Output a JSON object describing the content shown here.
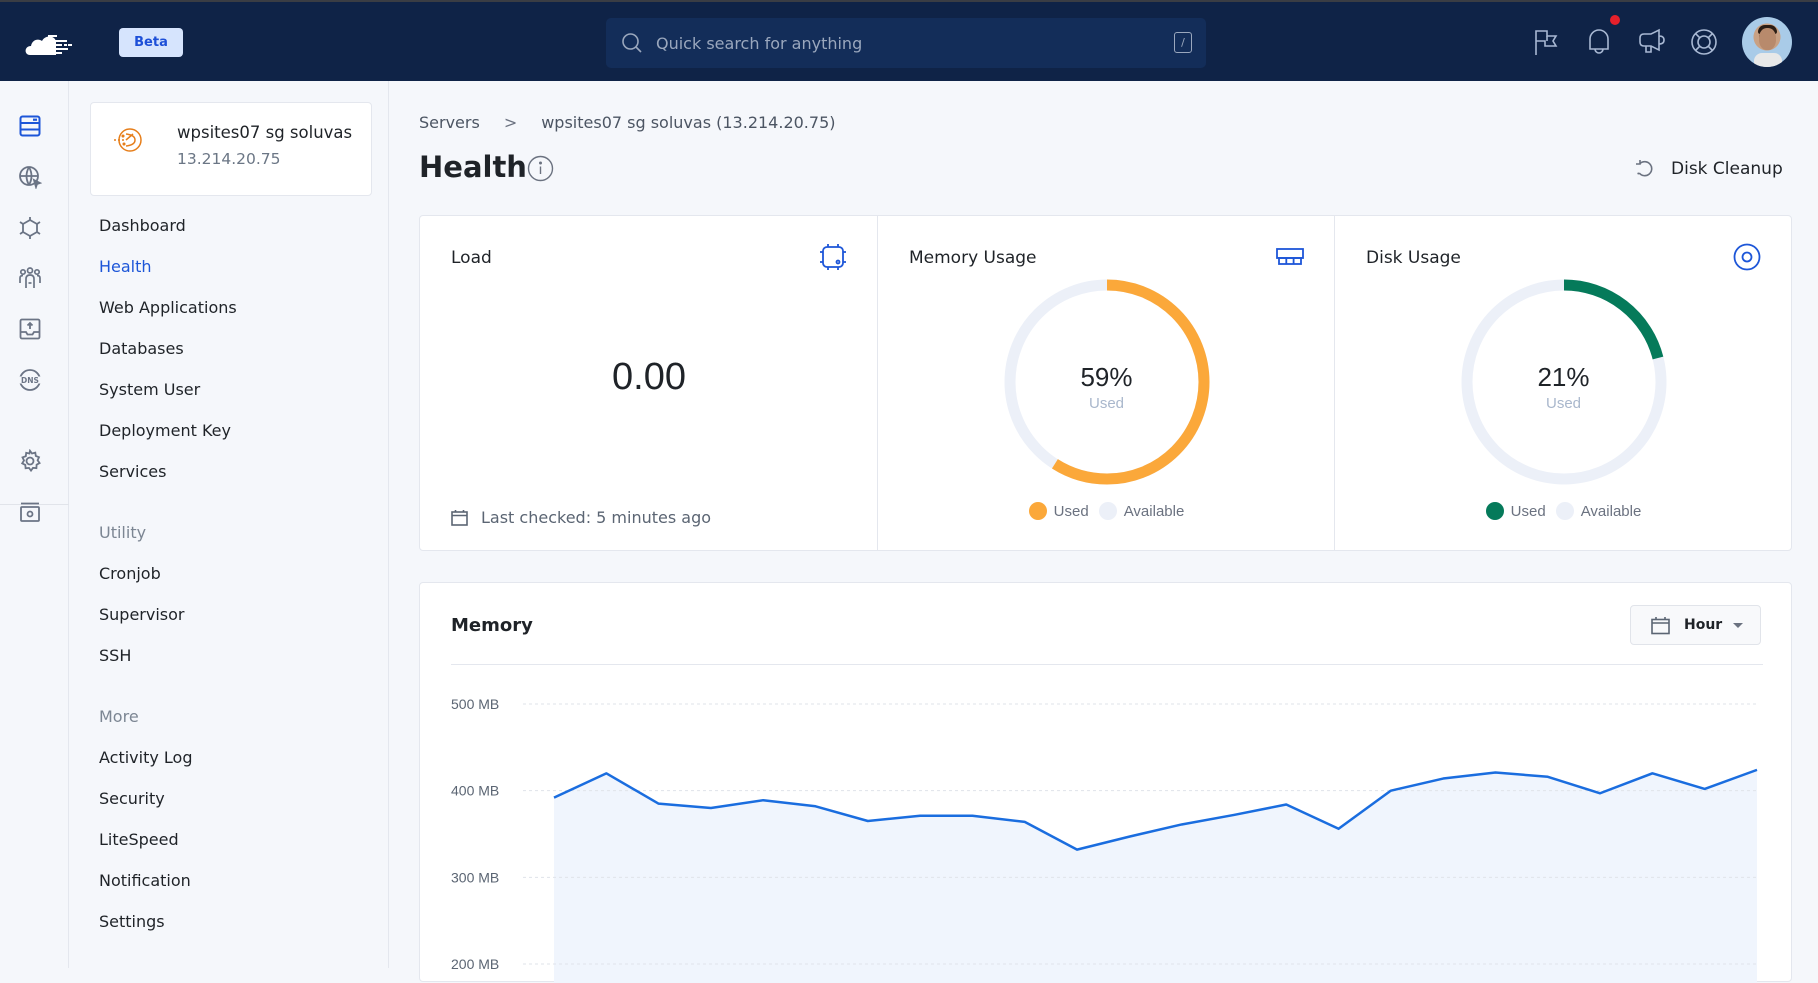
{
  "topbar": {
    "beta_label": "Beta",
    "search_placeholder": "Quick search for anything",
    "search_shortcut": "/",
    "icons": [
      "flag-icon",
      "bell-icon",
      "megaphone-icon",
      "lifebuoy-icon"
    ],
    "has_notification": true,
    "notification_color": "#e5202b"
  },
  "rail": {
    "items": [
      "servers-icon",
      "web-app-icon",
      "integrations-icon",
      "team-icon",
      "backup-icon",
      "dns-icon",
      "settings-icon",
      "billing-icon"
    ],
    "active": "servers-icon"
  },
  "server": {
    "name": "wpsites07 sg soluvas",
    "ip": "13.214.20.75"
  },
  "sidebar": {
    "main_items": [
      {
        "label": "Dashboard",
        "active": false
      },
      {
        "label": "Health",
        "active": true
      },
      {
        "label": "Web Applications",
        "active": false
      },
      {
        "label": "Databases",
        "active": false
      },
      {
        "label": "System User",
        "active": false
      },
      {
        "label": "Deployment Key",
        "active": false
      },
      {
        "label": "Services",
        "active": false
      }
    ],
    "utility_label": "Utility",
    "utility_items": [
      {
        "label": "Cronjob"
      },
      {
        "label": "Supervisor"
      },
      {
        "label": "SSH"
      }
    ],
    "more_label": "More",
    "more_items": [
      {
        "label": "Activity Log"
      },
      {
        "label": "Security"
      },
      {
        "label": "LiteSpeed"
      },
      {
        "label": "Notification"
      },
      {
        "label": "Settings"
      }
    ]
  },
  "breadcrumb": {
    "root": "Servers",
    "separator": ">",
    "current": "wpsites07 sg soluvas (13.214.20.75)"
  },
  "page": {
    "title": "Health",
    "disk_cleanup_label": "Disk Cleanup"
  },
  "load": {
    "title": "Load",
    "value": "0.00",
    "last_checked": "Last checked: 5 minutes ago"
  },
  "memory_usage": {
    "title": "Memory Usage",
    "percent_used": 59,
    "percent_label": "59%",
    "sub_label": "Used",
    "legend": [
      "Used",
      "Available"
    ],
    "used_color": "#fba83a",
    "available_color": "#ecf0f8"
  },
  "disk_usage": {
    "title": "Disk Usage",
    "percent_used": 21,
    "percent_label": "21%",
    "sub_label": "Used",
    "legend": [
      "Used",
      "Available"
    ],
    "used_color": "#057a5a",
    "available_color": "#ecf0f8"
  },
  "memory_chart": {
    "title": "Memory",
    "range_label": "Hour"
  },
  "chart_data": {
    "type": "area",
    "title": "Memory",
    "xlabel": "",
    "ylabel": "",
    "y_unit": "MB",
    "y_ticks": [
      "500 MB",
      "400 MB",
      "300 MB",
      "200 MB"
    ],
    "y_tick_values": [
      500,
      400,
      300,
      200
    ],
    "ylim": [
      200,
      500
    ],
    "grid": true,
    "line_color": "#1a6ddf",
    "fill_color": "#f0f5fd",
    "series": [
      {
        "name": "Memory",
        "values": [
          392,
          420,
          385,
          380,
          389,
          382,
          365,
          371,
          371,
          364,
          332,
          347,
          361,
          372,
          384,
          356,
          400,
          414,
          421,
          416,
          397,
          420,
          402,
          424
        ]
      }
    ]
  }
}
